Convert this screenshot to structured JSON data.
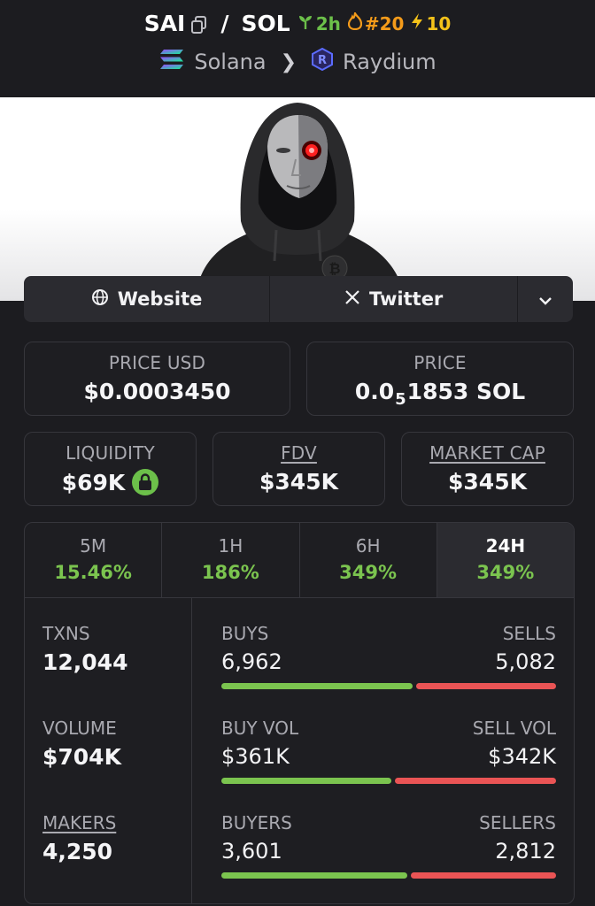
{
  "header": {
    "base_token": "SAI",
    "quote_token": "SOL",
    "age": "2h",
    "rank": "#20",
    "boosts": "10",
    "chain": "Solana",
    "dex": "Raydium"
  },
  "links": {
    "website": "Website",
    "twitter": "Twitter"
  },
  "stats": {
    "price_usd_label": "PRICE USD",
    "price_usd": "$0.0003450",
    "price_label": "PRICE",
    "price_prefix": "0.0",
    "price_zeros": "5",
    "price_suffix": "1853 SOL",
    "liquidity_label": "LIQUIDITY",
    "liquidity": "$69K",
    "fdv_label": "FDV",
    "fdv": "$345K",
    "mcap_label": "MARKET CAP",
    "mcap": "$345K"
  },
  "timeframes": [
    {
      "label": "5M",
      "change": "15.46%"
    },
    {
      "label": "1H",
      "change": "186%"
    },
    {
      "label": "6H",
      "change": "349%"
    },
    {
      "label": "24H",
      "change": "349%",
      "active": true
    }
  ],
  "txns": {
    "txns_label": "TXNS",
    "txns": "12,044",
    "volume_label": "VOLUME",
    "volume": "$704K",
    "makers_label": "MAKERS",
    "makers": "4,250",
    "buys_label": "BUYS",
    "buys": "6,962",
    "sells_label": "SELLS",
    "sells": "5,082",
    "buy_vol_label": "BUY VOL",
    "buy_vol": "$361K",
    "sell_vol_label": "SELL VOL",
    "sell_vol": "$342K",
    "buyers_label": "BUYERS",
    "buyers": "3,601",
    "sellers_label": "SELLERS",
    "sellers": "2,812",
    "buy_share": 0.578,
    "buy_vol_share": 0.513,
    "buyer_share": 0.561
  },
  "colors": {
    "positive": "#7bc44f",
    "negative": "#ea5455",
    "background": "#1c1c20"
  }
}
